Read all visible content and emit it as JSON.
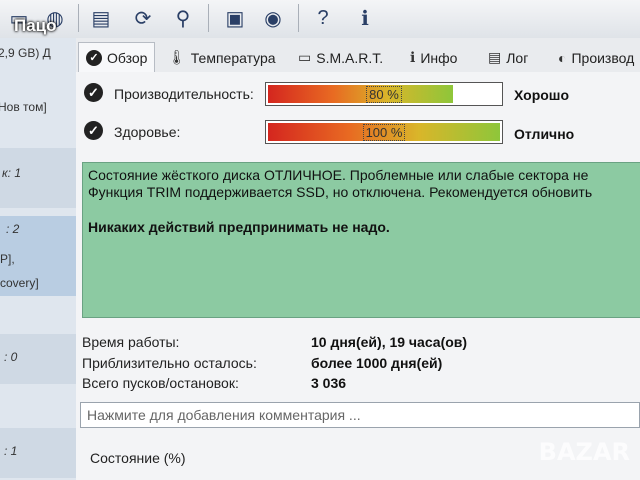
{
  "watermark": "Пацо",
  "toolbar": {
    "icons": [
      "drive-icon",
      "globe-icon",
      "document-icon",
      "refresh-icon",
      "network-icon",
      "monitor-icon",
      "disc-icon",
      "help-icon",
      "info-icon"
    ]
  },
  "sidebar": {
    "drive_size": "2,9 GB) Д",
    "volume": "Нов том]",
    "disk1": "к: 1",
    "disk2": ": 2",
    "disk2_detail": "P],",
    "recovery": "covery]",
    "disk0": ": 0",
    "partial": ": 1"
  },
  "tabs": [
    {
      "label": "Обзор",
      "icon": "check-icon",
      "active": true
    },
    {
      "label": "Температура",
      "icon": "thermometer-icon",
      "active": false
    },
    {
      "label": "S.M.A.R.T.",
      "icon": "drive-icon",
      "active": false
    },
    {
      "label": "Инфо",
      "icon": "info-icon",
      "active": false
    },
    {
      "label": "Лог",
      "icon": "document-icon",
      "active": false
    },
    {
      "label": "Производ",
      "icon": "gauge-icon",
      "active": false
    }
  ],
  "performance": {
    "label": "Производительность:",
    "percent": 80,
    "percent_text": "80 %",
    "rating": "Хорошо"
  },
  "health": {
    "label": "Здоровье:",
    "percent": 100,
    "percent_text": "100 %",
    "rating": "Отлично"
  },
  "status": {
    "line1": "Состояние жёсткого диска ОТЛИЧНОЕ. Проблемные или слабые сектора не",
    "line2": "Функция TRIM поддерживается SSD, но отключена. Рекомендуется обновить",
    "advice": "Никаких действий предпринимать не надо."
  },
  "info": {
    "uptime_label": "Время работы:",
    "uptime_value": "10 дня(ей), 19 часа(ов)",
    "remaining_label": "Приблизительно осталось:",
    "remaining_value": "более 1000 дня(ей)",
    "starts_label": "Всего пусков/остановок:",
    "starts_value": "3 036"
  },
  "comment": {
    "placeholder": "Нажмите для добавления комментария ..."
  },
  "state_label": "Состояние (%)",
  "site_watermark": "BAZAR",
  "colors": {
    "status_bg": "#8ccaa2",
    "bar_start": "#d4261f",
    "bar_end": "#8ec63a"
  }
}
